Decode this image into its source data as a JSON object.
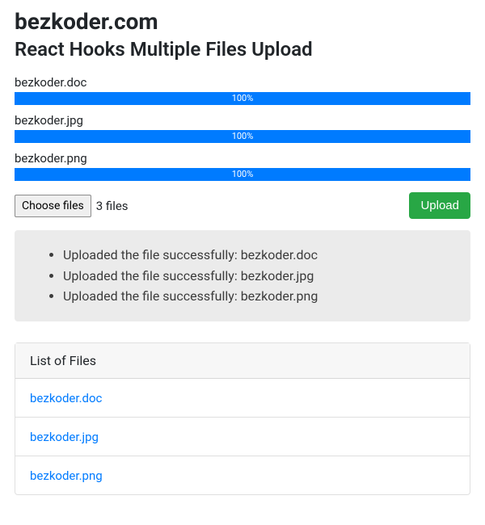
{
  "header": {
    "siteTitle": "bezkoder.com",
    "pageTitle": "React Hooks Multiple Files Upload"
  },
  "uploads": [
    {
      "name": "bezkoder.doc",
      "percent": 100,
      "percentLabel": "100%"
    },
    {
      "name": "bezkoder.jpg",
      "percent": 100,
      "percentLabel": "100%"
    },
    {
      "name": "bezkoder.png",
      "percent": 100,
      "percentLabel": "100%"
    }
  ],
  "filePicker": {
    "chooseLabel": "Choose files",
    "countText": "3 files",
    "uploadLabel": "Upload"
  },
  "messages": [
    "Uploaded the file successfully: bezkoder.doc",
    "Uploaded the file successfully: bezkoder.jpg",
    "Uploaded the file successfully: bezkoder.png"
  ],
  "fileList": {
    "header": "List of Files",
    "items": [
      "bezkoder.doc",
      "bezkoder.jpg",
      "bezkoder.png"
    ]
  },
  "colors": {
    "progress": "#007bff",
    "uploadBtn": "#28a745",
    "link": "#007bff"
  }
}
